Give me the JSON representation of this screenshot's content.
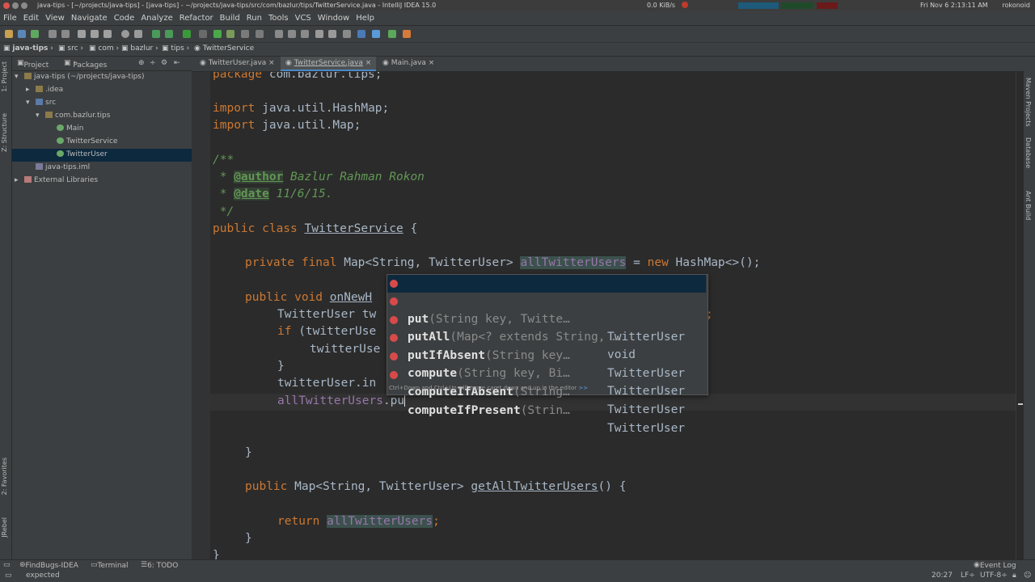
{
  "system_bar": {
    "window_title": "java-tips - [~/projects/java-tips] - [java-tips] - ~/projects/java-tips/src/com/bazlur/tips/TwitterService.java - IntelliJ IDEA 15.0",
    "net_speed": "0.0 KiB/s",
    "clock": "Fri Nov 6  2:13:11 AM",
    "user": "rokonoid"
  },
  "menu": [
    "File",
    "Edit",
    "View",
    "Navigate",
    "Code",
    "Analyze",
    "Refactor",
    "Build",
    "Run",
    "Tools",
    "VCS",
    "Window",
    "Help"
  ],
  "breadcrumbs": [
    "java-tips",
    "src",
    "com",
    "bazlur",
    "tips",
    "TwitterService"
  ],
  "project_panel": {
    "tabs": [
      "Project",
      "Packages"
    ],
    "tree": [
      {
        "label": "java-tips (~/projects/java-tips)",
        "depth": 0,
        "arrow": "▾",
        "icon": "module-folder-icon"
      },
      {
        "label": ".idea",
        "depth": 1,
        "arrow": "▸",
        "icon": "folder-icon"
      },
      {
        "label": "src",
        "depth": 1,
        "arrow": "▾",
        "icon": "source-folder-icon"
      },
      {
        "label": "com.bazlur.tips",
        "depth": 2,
        "arrow": "▾",
        "icon": "package-icon"
      },
      {
        "label": "Main",
        "depth": 3,
        "arrow": "",
        "icon": "class-icon"
      },
      {
        "label": "TwitterService",
        "depth": 3,
        "arrow": "",
        "icon": "class-icon"
      },
      {
        "label": "TwitterUser",
        "depth": 3,
        "arrow": "",
        "icon": "class-icon",
        "selected": true
      },
      {
        "label": "java-tips.iml",
        "depth": 1,
        "arrow": "",
        "icon": "iml-file-icon"
      },
      {
        "label": "External Libraries",
        "depth": 0,
        "arrow": "▸",
        "icon": "library-icon"
      }
    ]
  },
  "left_tool_labels": [
    "1: Project",
    "Z: Structure",
    "2: Favorites",
    "JRebel"
  ],
  "right_tool_labels": [
    "Maven Projects",
    "Database",
    "Ant Build"
  ],
  "editor_tabs": [
    {
      "label": "TwitterUser.java",
      "active": false
    },
    {
      "label": "TwitterService.java",
      "active": true
    },
    {
      "label": "Main.java",
      "active": false
    }
  ],
  "code": {
    "l1": [
      "package",
      " com.bazlur.tips;"
    ],
    "l2": [
      "import",
      " java.util.HashMap;"
    ],
    "l3": [
      "import",
      " java.util.Map;"
    ],
    "l4": "/**",
    "l5": [
      " * ",
      "@author",
      " Bazlur Rahman Rokon"
    ],
    "l6": [
      " * ",
      "@date",
      " 11/6/15."
    ],
    "l7": " */",
    "l8": [
      "public class ",
      "TwitterService",
      " {"
    ],
    "l9": [
      "private final ",
      "Map<String, TwitterUser> ",
      "allTwitterUsers",
      " = ",
      "new ",
      "HashMap<>();"
    ],
    "l10": [
      "public void ",
      "onNewH"
    ],
    "l11": "TwitterUser tw",
    "l11b": ";",
    "l12": [
      "if ",
      "(twitterUse"
    ],
    "l13": "twitterUse",
    "l14": "}",
    "l15": "twitterUser.in",
    "l16": [
      "allTwitterUsers",
      ".pu"
    ],
    "l17": "}",
    "l18": [
      "public ",
      "Map<String, TwitterUser> ",
      "getAllTwitterUsers",
      "() {"
    ],
    "l19": [
      "return ",
      "allTwitterUsers",
      ";"
    ],
    "l20": "}",
    "l21": "}"
  },
  "completion": {
    "items": [
      {
        "match": "put",
        "rest": "",
        "sig": "(String key, Twitte…",
        "ret": "TwitterUser"
      },
      {
        "match": "put",
        "rest": "All",
        "sig": "(Map<? extends String, …",
        "ret": "void"
      },
      {
        "match": "put",
        "rest": "IfAbsent",
        "sig": "(String key…",
        "ret": "TwitterUser"
      },
      {
        "match": "",
        "rest": "compute",
        "sig": "(String key, Bi…",
        "ret": "TwitterUser"
      },
      {
        "match": "",
        "rest": "computeIfAbsent",
        "sig": "(String…",
        "ret": "TwitterUser"
      },
      {
        "match": "",
        "rest": "computeIfPresent",
        "sig": "(Strin…",
        "ret": "TwitterUser"
      }
    ],
    "hint": "Ctrl+Down and Ctrl+Up will move caret down and up in the editor",
    "hint_link": ">>"
  },
  "bottom_tools": [
    "FindBugs-IDEA",
    "Terminal",
    "6: TODO"
  ],
  "event_log": "Event Log",
  "status": {
    "message": "expected",
    "position": "20:27",
    "line_sep": "LF÷",
    "encoding": "UTF-8÷"
  },
  "colors": {
    "background": "#2b2b2b",
    "keyword": "#cc7832",
    "field": "#9876aa",
    "comment": "#629755",
    "selection": "#0d293e"
  }
}
